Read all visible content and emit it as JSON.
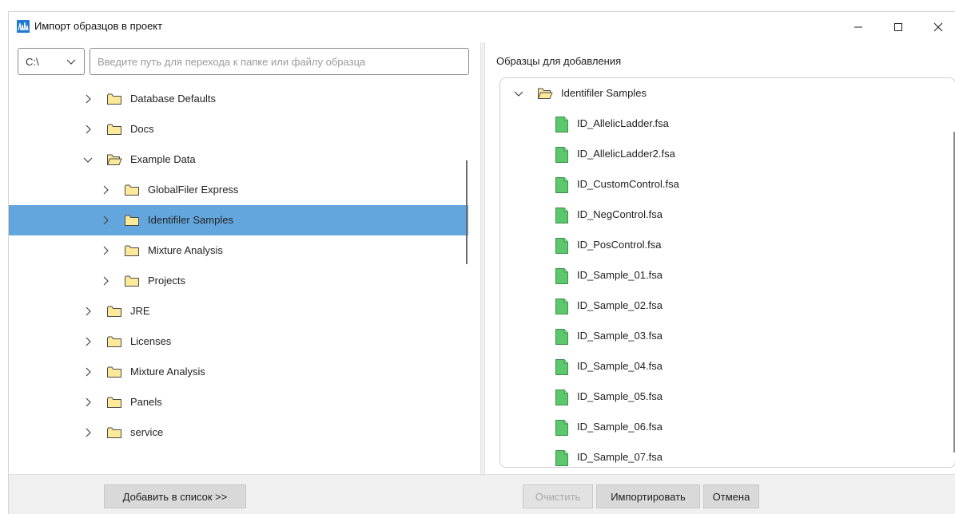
{
  "window": {
    "title": "Импорт образцов в проект",
    "controls": {
      "minimize": "—",
      "maximize": "☐",
      "close": "✕"
    }
  },
  "left": {
    "drive": "C:\\",
    "path_placeholder": "Введите путь для перехода к папке или файлу образца",
    "tree": [
      {
        "label": "Database Defaults",
        "level": 0,
        "expanded": false,
        "selected": false
      },
      {
        "label": "Docs",
        "level": 0,
        "expanded": false,
        "selected": false
      },
      {
        "label": "Example Data",
        "level": 0,
        "expanded": true,
        "selected": false
      },
      {
        "label": "GlobalFiler Express",
        "level": 1,
        "expanded": false,
        "selected": false
      },
      {
        "label": "Identifiler Samples",
        "level": 1,
        "expanded": false,
        "selected": true
      },
      {
        "label": "Mixture Analysis",
        "level": 1,
        "expanded": false,
        "selected": false
      },
      {
        "label": "Projects",
        "level": 1,
        "expanded": false,
        "selected": false
      },
      {
        "label": "JRE",
        "level": 0,
        "expanded": false,
        "selected": false
      },
      {
        "label": "Licenses",
        "level": 0,
        "expanded": false,
        "selected": false
      },
      {
        "label": "Mixture Analysis",
        "level": 0,
        "expanded": false,
        "selected": false
      },
      {
        "label": "Panels",
        "level": 0,
        "expanded": false,
        "selected": false
      },
      {
        "label": "service",
        "level": 0,
        "expanded": false,
        "selected": false
      }
    ]
  },
  "right": {
    "title": "Образцы для добавления",
    "folder": "Identifiler Samples",
    "files": [
      "ID_AllelicLadder.fsa",
      "ID_AllelicLadder2.fsa",
      "ID_CustomControl.fsa",
      "ID_NegControl.fsa",
      "ID_PosControl.fsa",
      "ID_Sample_01.fsa",
      "ID_Sample_02.fsa",
      "ID_Sample_03.fsa",
      "ID_Sample_04.fsa",
      "ID_Sample_05.fsa",
      "ID_Sample_06.fsa",
      "ID_Sample_07.fsa"
    ]
  },
  "footer": {
    "add_to_list": "Добавить в список >>",
    "clear": "Очистить",
    "import": "Импортировать",
    "cancel": "Отмена"
  },
  "colors": {
    "selection": "#63a6dd",
    "folder": "#fde99a",
    "file": "#5cc86e"
  },
  "icons": {
    "app": "chromatogram-icon",
    "folder_closed": "folder-icon",
    "folder_open": "folder-open-icon",
    "file": "fsa-file-icon"
  }
}
